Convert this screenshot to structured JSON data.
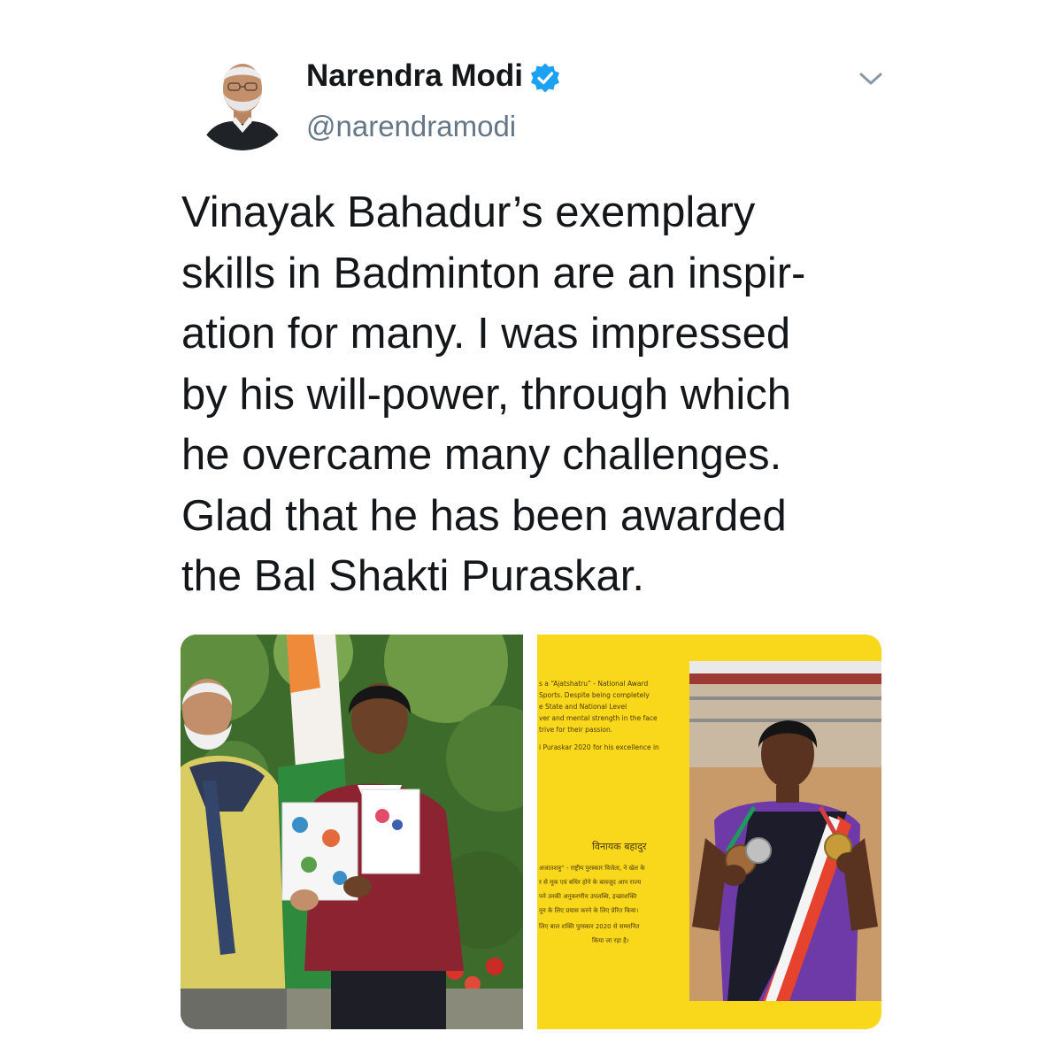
{
  "author": {
    "name": "Narendra Modi",
    "handle": "@narendramodi",
    "verified": true
  },
  "icons": {
    "verified": "verified-badge-icon",
    "menu": "chevron-down-icon"
  },
  "tweet": {
    "lines": [
      "Vinayak Bahadur’s exemplary",
      "skills in Badminton are an inspir-",
      "ation for many. I was impressed",
      "by his will-power, through which",
      "he overcame many challenges.",
      "Glad that he has been awarded",
      "the Bal Shakti Puraskar."
    ]
  },
  "media": {
    "right_photo": {
      "english_lines": [
        "s a “Ajatshatru” - National Award",
        "Sports. Despite being completely",
        "e State and National Level",
        "ver and mental strength in the face",
        "trive for their passion.",
        "i Puraskar 2020 for his excellence in"
      ],
      "hindi_title": "विनायक बहादुर",
      "hindi_lines": [
        "अजातशत्रु” - राष्ट्रीय पुरस्कार विजेता, ने खेल के",
        "र से मूक एवं बधिर होने के बावजूद आप राज्य",
        "पने उनकी अनुकरणीय उपलब्धि, इच्छाशक्ति",
        "नून के लिए प्रयास करने के लिए प्रेरित किया।",
        "लिए बाल शक्ति पुरस्कार 2020 से सम्मानित",
        "किया जा रहा है।"
      ]
    }
  },
  "colors": {
    "verified_blue": "#1da1f2",
    "secondary_text": "#657786",
    "booklet_yellow": "#f9d81b"
  }
}
